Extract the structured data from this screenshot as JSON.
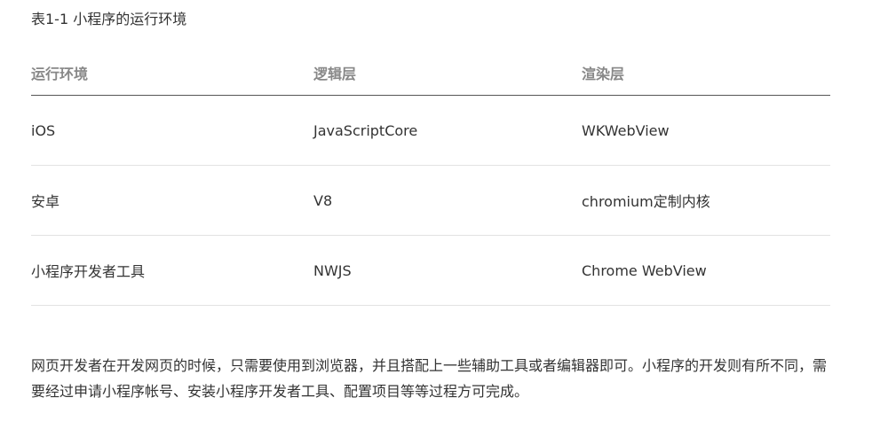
{
  "caption": "表1-1 小程序的运行环境",
  "table": {
    "headers": [
      "运行环境",
      "逻辑层",
      "渲染层"
    ],
    "rows": [
      [
        "iOS",
        "JavaScriptCore",
        "WKWebView"
      ],
      [
        "安卓",
        "V8",
        "chromium定制内核"
      ],
      [
        "小程序开发者工具",
        "NWJS",
        "Chrome WebView"
      ]
    ]
  },
  "paragraph": "网页开发者在开发网页的时候，只需要使用到浏览器，并且搭配上一些辅助工具或者编辑器即可。小程序的开发则有所不同，需要经过申请小程序帐号、安装小程序开发者工具、配置项目等等过程方可完成。",
  "colors": {
    "text": "#333333",
    "header_text": "#888888",
    "header_border": "#555555",
    "row_border": "#e2e2e2"
  }
}
